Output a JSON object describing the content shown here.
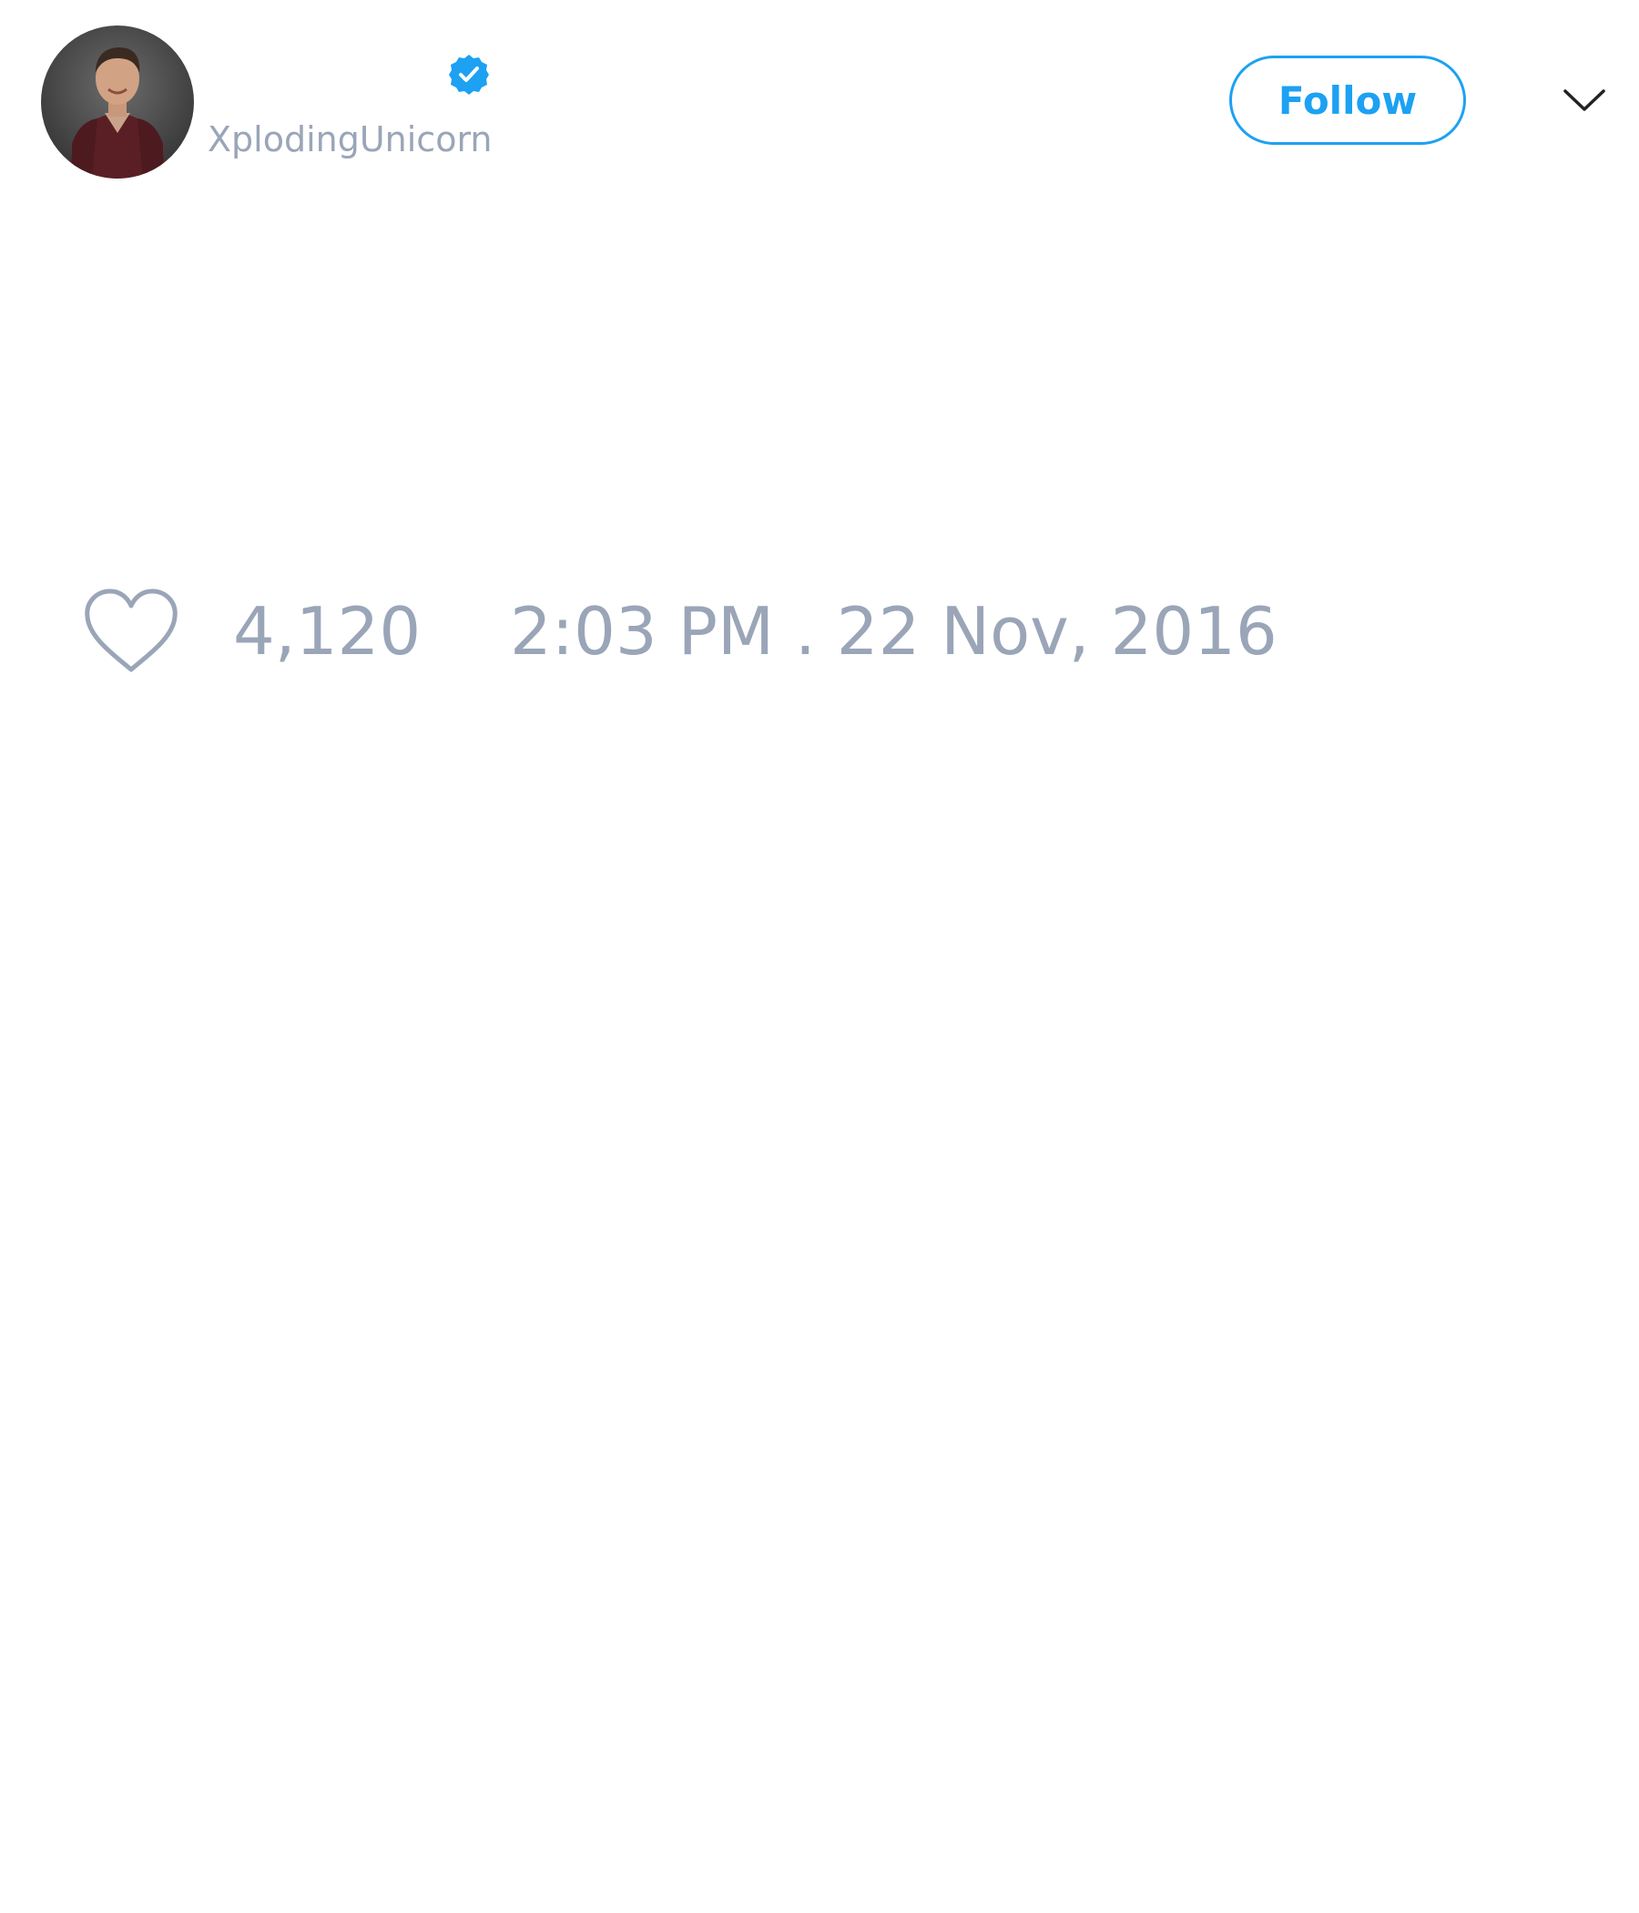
{
  "tweet": {
    "author": {
      "handle": "XplodingUnicorn",
      "verified": true,
      "avatar_icon": "profile-photo"
    },
    "follow_label": "Follow",
    "menu_icon": "chevron-down-icon",
    "likes": "4,120",
    "timestamp": "2:03 PM . 22 Nov, 2016"
  },
  "colors": {
    "accent": "#1da1f2",
    "muted_text": "#9aa5b8",
    "background": "#ffffff"
  }
}
